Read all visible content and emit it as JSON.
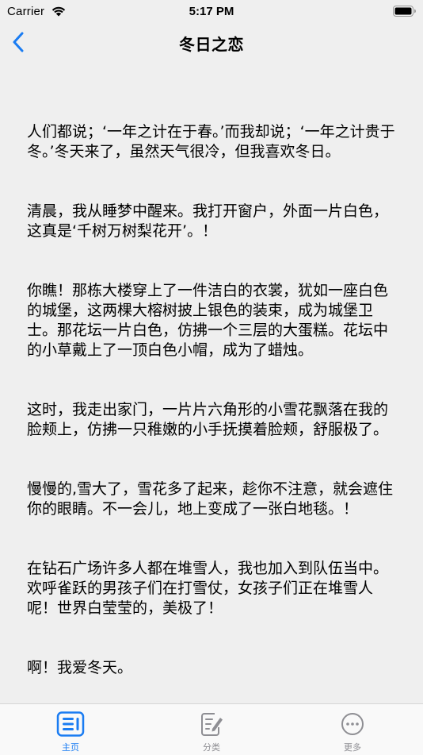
{
  "status_bar": {
    "carrier": "Carrier",
    "time": "5:17 PM"
  },
  "nav": {
    "title": "冬日之恋",
    "back_icon": "chevron-left-icon"
  },
  "article": {
    "paragraphs": [
      "人们都说；‘一年之计在于春。’而我却说；‘一年之计贵于冬。’冬天来了，虽然天气很冷，但我喜欢冬日。",
      "清晨，我从睡梦中醒来。我打开窗户，外面一片白色，这真是‘千树万树梨花开’。！",
      "你瞧！那栋大楼穿上了一件洁白的衣裳，犹如一座白色的城堡，这两棵大榕树披上银色的装束，成为城堡卫士。那花坛一片白色，仿拂一个三层的大蛋糕。花坛中的小草戴上了一顶白色小帽，成为了蜡烛。",
      "这时，我走出家门，一片片六角形的小雪花飘落在我的脸颊上，仿拂一只稚嫩的小手抚摸着脸颊，舒服极了。",
      "慢慢的,雪大了，雪花多了起来，趁你不注意，就会遮住你的眼睛。不一会儿，地上变成了一张白地毯。！",
      "在钻石广场许多人都在堆雪人，我也加入到队伍当中。欢呼雀跃的男孩子们在打雪仗，女孩子们正在堆雪人呢！世界白莹莹的，美极了！",
      "啊！我爱冬天。"
    ]
  },
  "tabs": [
    {
      "label": "主页",
      "icon": "home-list-icon",
      "active": true
    },
    {
      "label": "分类",
      "icon": "edit-document-icon",
      "active": false
    },
    {
      "label": "更多",
      "icon": "more-dots-icon",
      "active": false
    }
  ],
  "colors": {
    "accent": "#1a7cf2",
    "inactive": "#8e8e93",
    "background": "#efefef",
    "tab_bar": "#f9f9f9"
  }
}
